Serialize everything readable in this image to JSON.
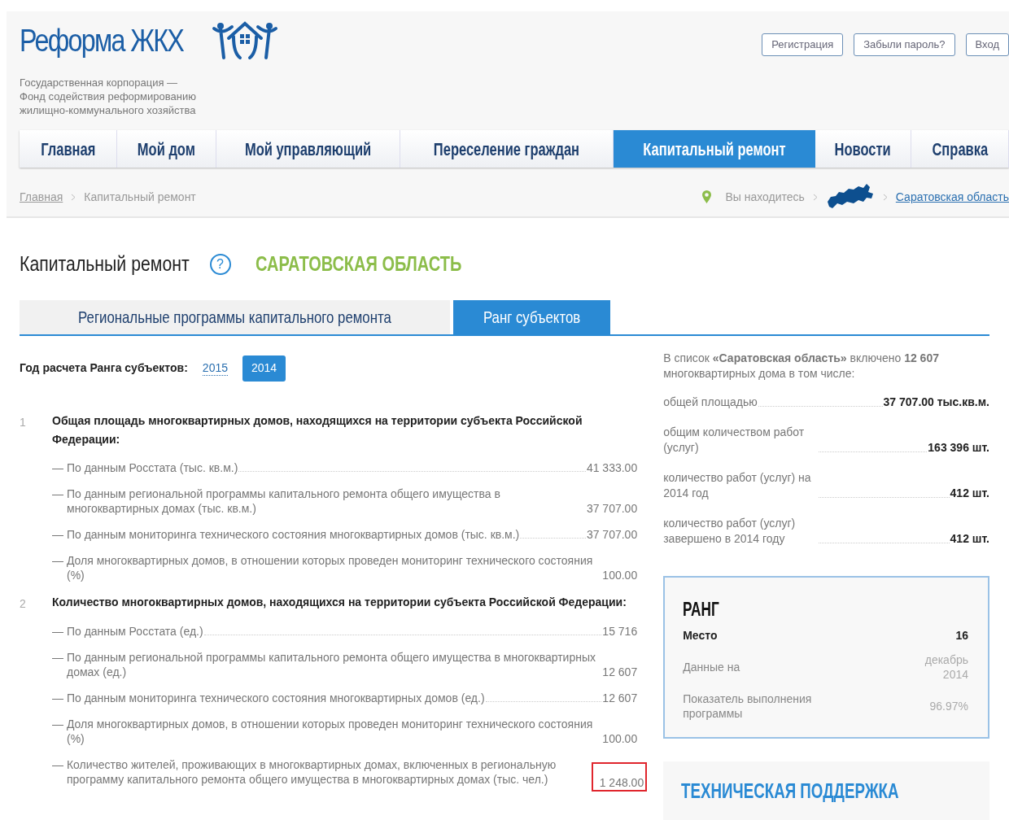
{
  "header": {
    "logo_text": "Реформа ЖКХ",
    "org_lines": [
      "Государственная корпорация —",
      "Фонд содействия реформированию",
      "жилищно-коммунального хозяйства"
    ],
    "auth_buttons": [
      "Регистрация",
      "Забыли пароль?",
      "Вход"
    ],
    "nav": [
      {
        "label": "Главная",
        "selected": false
      },
      {
        "label": "Мой дом",
        "selected": false
      },
      {
        "label": "Мой управляющий",
        "selected": false
      },
      {
        "label": "Переселение граждан",
        "selected": false
      },
      {
        "label": "Капитальный ремонт",
        "selected": true
      },
      {
        "label": "Новости",
        "selected": false
      },
      {
        "label": "Справка",
        "selected": false
      }
    ],
    "breadcrumb": {
      "link": "Главная",
      "current": "Капитальный ремонт"
    },
    "location": {
      "label": "Вы находитесь",
      "region": "Саратовская область"
    }
  },
  "page": {
    "title": "Капитальный ремонт",
    "help": "?",
    "region": "САРАТОВСКАЯ ОБЛАСТЬ",
    "tabs": [
      {
        "label": "Региональные программы капитального ремонта",
        "selected": false
      },
      {
        "label": "Ранг субъектов",
        "selected": true
      }
    ],
    "year_label": "Год расчета Ранга субъектов:",
    "years": [
      {
        "label": "2015",
        "selected": false
      },
      {
        "label": "2014",
        "selected": true
      }
    ],
    "sections": [
      {
        "number": "1",
        "title": "Общая площадь многоквартирных домов, находящихся на территории субъекта Российской Федерации:",
        "rows": [
          {
            "label": "— По данным Росстата (тыс. кв.м.)",
            "value": "41 333.00",
            "highlighted": false
          },
          {
            "label": "— По данным региональной программы капитального ремонта общего имущества в многоквартирных домах (тыс. кв.м.)",
            "value": "37 707.00",
            "highlighted": false
          },
          {
            "label": "— По данным мониторинга технического состояния многоквартирных домов (тыс. кв.м.)",
            "value": "37 707.00",
            "highlighted": false
          },
          {
            "label": "— Доля многоквартирных домов, в отношении которых проведен мониторинг технического состояния (%)",
            "value": "100.00",
            "highlighted": false
          }
        ]
      },
      {
        "number": "2",
        "title": "Количество многоквартирных домов, находящихся на территории субъекта Российской Федерации:",
        "rows": [
          {
            "label": "— По данным Росстата (ед.)",
            "value": "15 716",
            "highlighted": false
          },
          {
            "label": "— По данным региональной программы капитального ремонта общего имущества в многоквартирных домах (ед.)",
            "value": "12 607",
            "highlighted": false
          },
          {
            "label": "— По данным мониторинга технического состояния многоквартирных домов (ед.)",
            "value": "12 607",
            "highlighted": false
          },
          {
            "label": "— Доля многоквартирных домов, в отношении которых проведен мониторинг технического состояния (%)",
            "value": "100.00",
            "highlighted": false
          },
          {
            "label": "— Количество жителей, проживающих в многоквартирных домах, включенных в региональную программу капитального ремонта общего имущества в многоквартирных домах (тыс. чел.)",
            "value": "1 248.00",
            "highlighted": true
          }
        ]
      }
    ]
  },
  "summary": {
    "intro": "В список **«Саратовская область»** включено **12 607** многоквартирных дома в том числе:",
    "items": [
      {
        "label": "общей площадью",
        "value": "37 707.00 тыс.кв.м."
      },
      {
        "label": "общим количеством работ (услуг)",
        "value": "163 396 шт."
      },
      {
        "label": "количество работ (услуг) на 2014 год",
        "value": "412 шт."
      },
      {
        "label": "количество работ (услуг) завершено в 2014 году",
        "value": "412 шт."
      }
    ]
  },
  "rank": {
    "title": "РАНГ",
    "rows": [
      {
        "label": "Место",
        "value": "16",
        "kind": "main"
      },
      {
        "label": "Данные на",
        "value": "декабрь 2014",
        "kind": "plain"
      },
      {
        "label": "Показатель выполнения программы",
        "value": "96.97%",
        "kind": "plain"
      }
    ]
  },
  "support": {
    "title": "ТЕХНИЧЕСКАЯ ПОДДЕРЖКА"
  }
}
